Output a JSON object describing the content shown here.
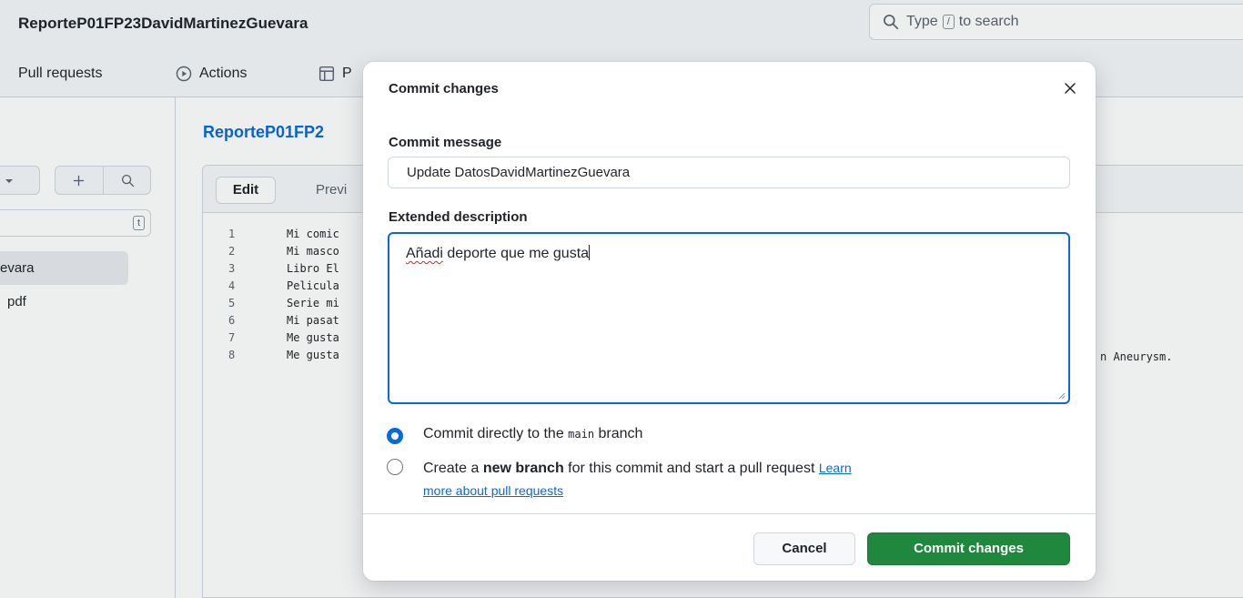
{
  "header": {
    "repo_title": "ReporteP01FP23DavidMartinezGuevara",
    "search": {
      "prefix": "Type",
      "key": "/",
      "suffix": "to search"
    }
  },
  "nav": {
    "pull_requests": "Pull requests",
    "actions": "Actions",
    "projects_partial": "P"
  },
  "sidebar": {
    "filter_key": "t",
    "files": [
      "evara",
      "pdf"
    ]
  },
  "editor": {
    "file_crumb": "ReporteP01FP2",
    "tab_edit": "Edit",
    "tab_preview": "Previ",
    "lines": [
      {
        "n": "1",
        "text": "Mi comic"
      },
      {
        "n": "2",
        "text": "Mi masco"
      },
      {
        "n": "3",
        "text": "Libro El"
      },
      {
        "n": "4",
        "text": "Pelicula"
      },
      {
        "n": "5",
        "text": "Serie mi"
      },
      {
        "n": "6",
        "text": "Mi pasat"
      },
      {
        "n": "7",
        "text": "Me gusta"
      },
      {
        "n": "8",
        "text": "Me gusta"
      }
    ],
    "line7_tail": "n Aneurysm."
  },
  "dialog": {
    "title": "Commit changes",
    "commit_message_label": "Commit message",
    "commit_message_value": "Update DatosDavidMartinezGuevara",
    "extended_label": "Extended description",
    "extended_word1": "Añadi",
    "extended_rest": " deporte que me gusta",
    "option_direct": {
      "before": "Commit directly to the ",
      "branch": "main",
      "after": " branch",
      "selected": true
    },
    "option_new": {
      "before": "Create a ",
      "bold": "new branch",
      "after": " for this commit and start a pull request ",
      "link1": "Learn",
      "link2": "more about pull requests",
      "selected": false
    },
    "cancel_label": "Cancel",
    "commit_label": "Commit changes"
  },
  "colors": {
    "accent": "#0969da",
    "commit_button": "#1f883d",
    "link": "#0969da"
  }
}
